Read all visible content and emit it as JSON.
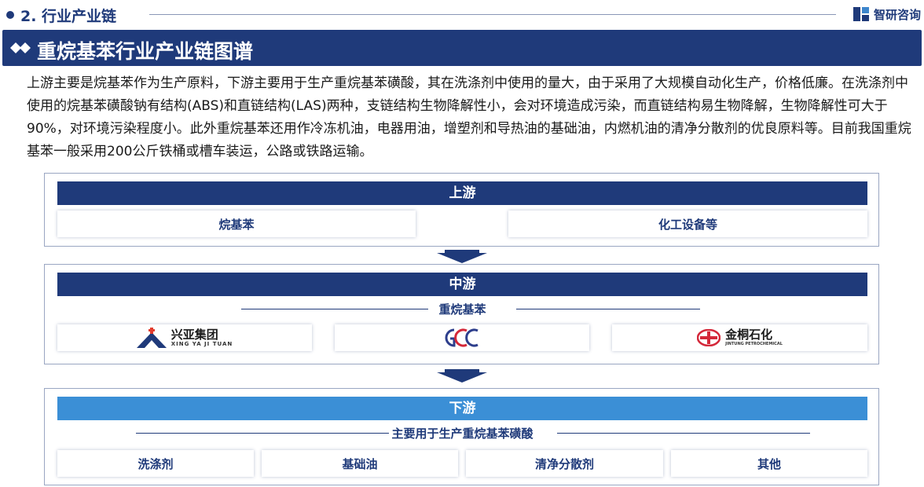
{
  "header": {
    "section_title": "2. 行业产业链",
    "brand": "智研咨询"
  },
  "title": "重烷基苯行业产业链图谱",
  "intro": "上游主要是烷基苯作为生产原料，下游主要用于生产重烷基苯磺酸，其在洗涤剂中使用的量大，由于采用了大规模自动化生产，价格低廉。在洗涤剂中使用的烷基苯磺酸钠有结构(ABS)和直链结构(LAS)两种，支链结构生物降解性小，会对环境造成污染，而直链结构易生物降解，生物降解性可大于90%，对环境污染程度小。此外重烷基苯还用作冷冻机油，电器用油，增塑剂和导热油的基础油，内燃机油的清净分散剂的优良原料等。目前我国重烷基苯一般采用200公斤铁桶或槽车装运，公路或铁路运输。",
  "upstream": {
    "label": "上游",
    "items": [
      "烷基苯",
      "化工设备等"
    ]
  },
  "midstream": {
    "label": "中游",
    "product": "重烷基苯",
    "companies": [
      {
        "name": "兴亚集团",
        "sub": "XING YA JI TUAN",
        "icon": "mountain-logo-icon"
      },
      {
        "name": "",
        "sub": "",
        "icon": "gcc-logo-icon"
      },
      {
        "name": "金桐石化",
        "sub": "JINTUNG PETROCHEMICAL",
        "icon": "jintung-logo-icon"
      }
    ]
  },
  "downstream": {
    "label": "下游",
    "product": "主要用于生产重烷基苯磺酸",
    "items": [
      "洗涤剂",
      "基础油",
      "清净分散剂",
      "其他"
    ]
  },
  "colors": {
    "navy": "#1f3a7a",
    "light_blue": "#3b8fd6"
  }
}
